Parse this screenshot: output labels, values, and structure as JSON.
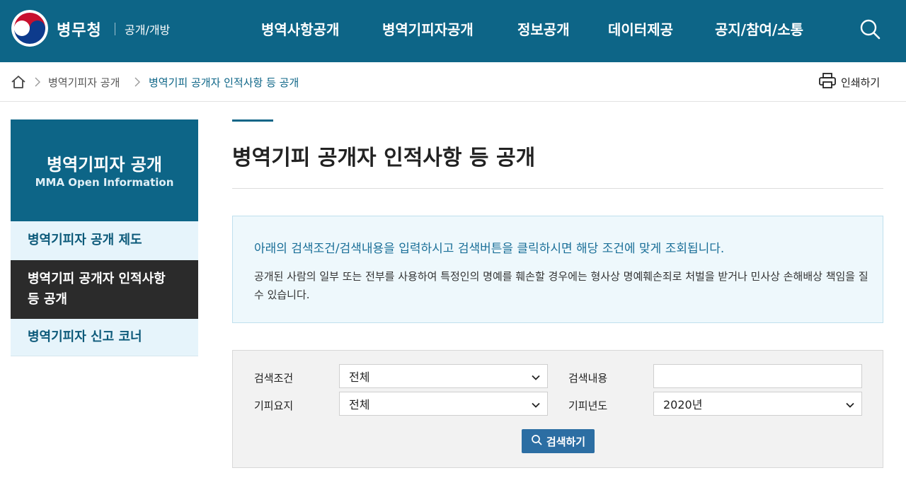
{
  "header": {
    "logo_text": "병무청",
    "logo_sub": "공개/개방",
    "nav": [
      {
        "label": "병역사항공개"
      },
      {
        "label": "병역기피자공개"
      },
      {
        "label": "정보공개"
      },
      {
        "label": "데이터제공"
      },
      {
        "label": "공지/참여/소통"
      }
    ],
    "search_icon": "search-icon"
  },
  "breadcrumb": {
    "home_icon": "home-icon",
    "items": [
      {
        "label": "병역기피자 공개"
      },
      {
        "label": "병역기피 공개자 인적사항 등 공개"
      }
    ],
    "print_label": "인쇄하기"
  },
  "sidebar": {
    "title": "병역기피자 공개",
    "subtitle": "MMA Open Information",
    "items": [
      {
        "label": "병역기피자 공개 제도"
      },
      {
        "label": "병역기피 공개자 인적사항 등 공개",
        "active": true
      },
      {
        "label": "병역기피자 신고 코너"
      }
    ]
  },
  "main": {
    "title": "병역기피 공개자 인적사항 등 공개",
    "notice_main": "아래의 검색조건/검색내용을 입력하시고 검색버튼을 클릭하시면 해당 조건에 맞게 조회됩니다.",
    "notice_sub": "공개된 사람의 일부 또는 전부를 사용하여 특정인의 명예를 훼손할 경우에는 형사상 명예훼손죄로 처벌을 받거나 민사상 손해배상 책임을 질 수 있습니다."
  },
  "search_form": {
    "condition_label": "검색조건",
    "condition_value": "전체",
    "keyword_label": "검색내용",
    "keyword_value": "",
    "evasion_label": "기피요지",
    "evasion_value": "전체",
    "year_label": "기피년도",
    "year_value": "2020년",
    "search_button": "검색하기"
  },
  "colors": {
    "header_bg": "#0d6587",
    "sidebar_active": "#2b2b2b",
    "sidebar_item_bg": "#e6f4fb",
    "notice_bg": "#eef8fc",
    "button": "#2c6ea3"
  }
}
